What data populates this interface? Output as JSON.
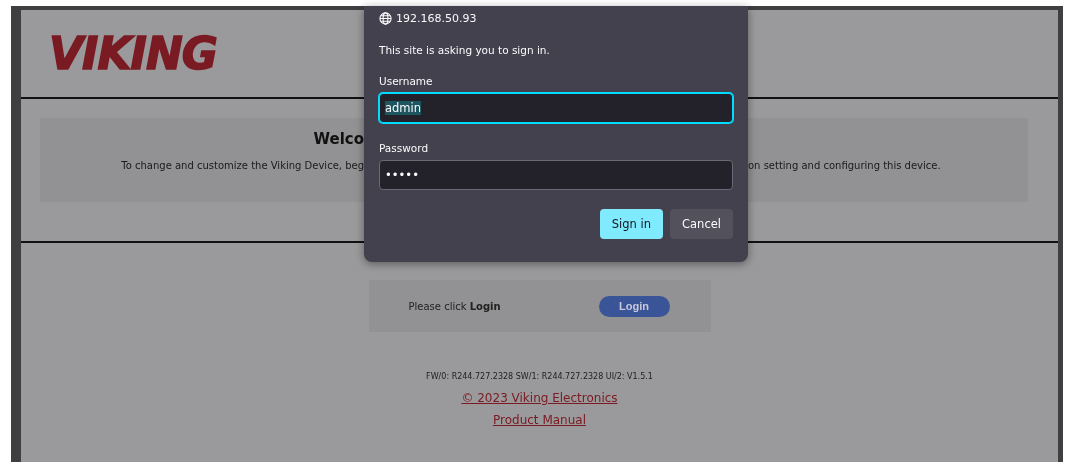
{
  "page": {
    "logo": "VIKING",
    "welcome": {
      "heading": "Welco",
      "text_left": "To change and customize the Viking Device, beg",
      "text_right": "on setting and configuring this device."
    },
    "login": {
      "prompt": "Please click **Login**",
      "button": "Login"
    },
    "version": "FW/0: R244.727.2328 SW/1: R244.727.2328 UI/2: V1.5.1",
    "links": [
      "© 2023 Viking Electronics",
      "Product Manual"
    ]
  },
  "dialog": {
    "site": "192.168.50.93",
    "message": "This site is asking you to sign in.",
    "fields": [
      {
        "label": "Username",
        "value": "admin",
        "focused": true
      },
      {
        "label": "Password",
        "value": "•••••",
        "focused": false
      }
    ],
    "buttons": [
      {
        "label": "Sign in",
        "primary": true
      },
      {
        "label": "Cancel",
        "primary": false
      }
    ]
  }
}
